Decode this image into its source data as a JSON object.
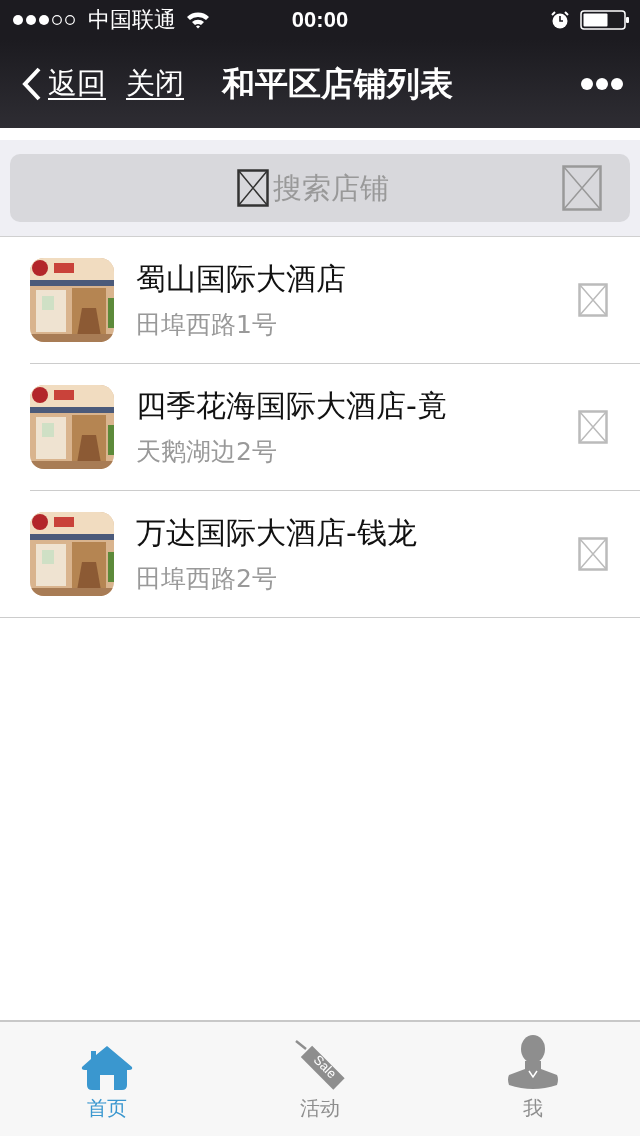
{
  "status_bar": {
    "carrier": "中国联通",
    "time": "00:00"
  },
  "nav": {
    "back": "返回",
    "close": "关闭",
    "title": "和平区店铺列表"
  },
  "search": {
    "placeholder": "搜索店铺"
  },
  "stores": [
    {
      "name": "蜀山国际大酒店",
      "address": "田埠西路1号"
    },
    {
      "name": "四季花海国际大酒店-竟",
      "address": "天鹅湖边2号"
    },
    {
      "name": "万达国际大酒店-钱龙",
      "address": "田埠西路2号"
    }
  ],
  "tabs": [
    {
      "kind": "home",
      "label": "首页",
      "selected": true
    },
    {
      "kind": "sale",
      "label": "活动",
      "tag_text": "Sale",
      "selected": false
    },
    {
      "kind": "user",
      "label": "我",
      "selected": false
    }
  ]
}
